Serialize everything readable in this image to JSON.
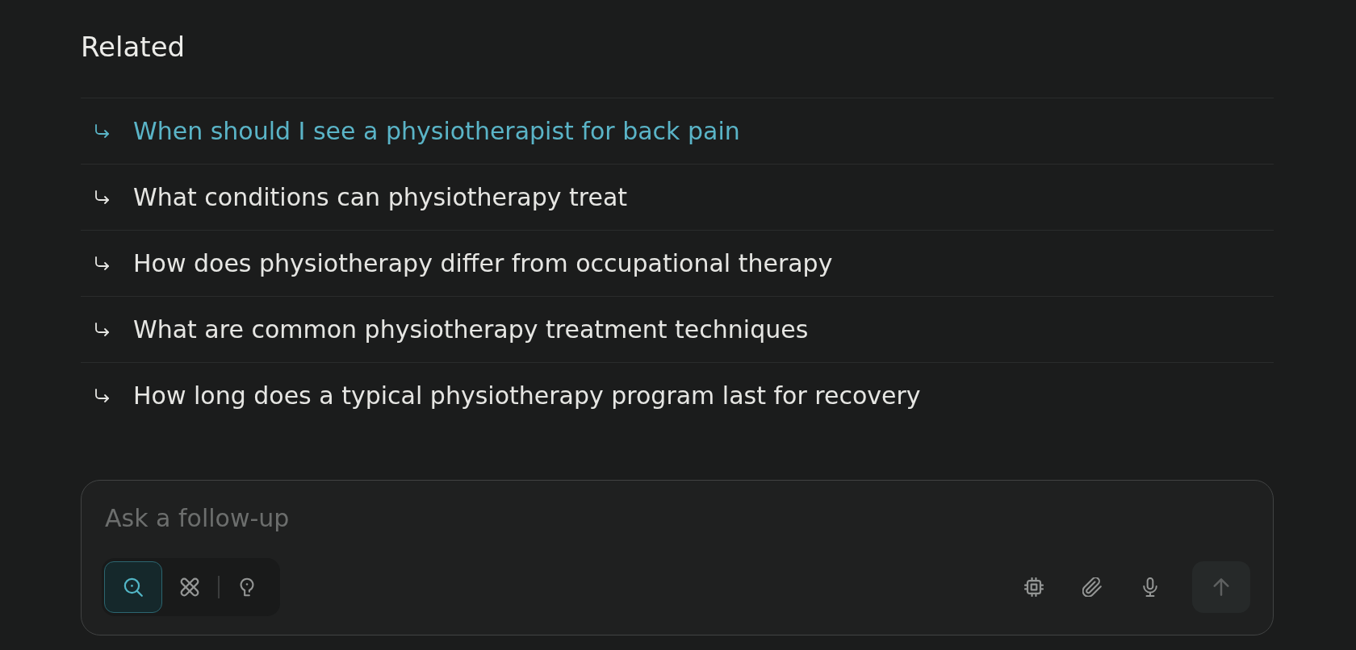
{
  "heading": "Related",
  "related": [
    {
      "text": "When should I see a physiotherapist for back pain",
      "hovered": true
    },
    {
      "text": "What conditions can physiotherapy treat",
      "hovered": false
    },
    {
      "text": "How does physiotherapy differ from occupational therapy",
      "hovered": false
    },
    {
      "text": "What are common physiotherapy treatment techniques",
      "hovered": false
    },
    {
      "text": "How long does a typical physiotherapy program last for recovery",
      "hovered": false
    }
  ],
  "follow_up": {
    "placeholder": "Ask a follow-up",
    "modes": [
      {
        "kind": "search",
        "selected": true
      },
      {
        "kind": "orbit",
        "selected": false
      },
      {
        "kind": "bulb",
        "selected": false
      }
    ],
    "tools": [
      {
        "kind": "chip"
      },
      {
        "kind": "paperclip"
      },
      {
        "kind": "mic"
      }
    ],
    "send": {
      "disabled": true
    }
  }
}
